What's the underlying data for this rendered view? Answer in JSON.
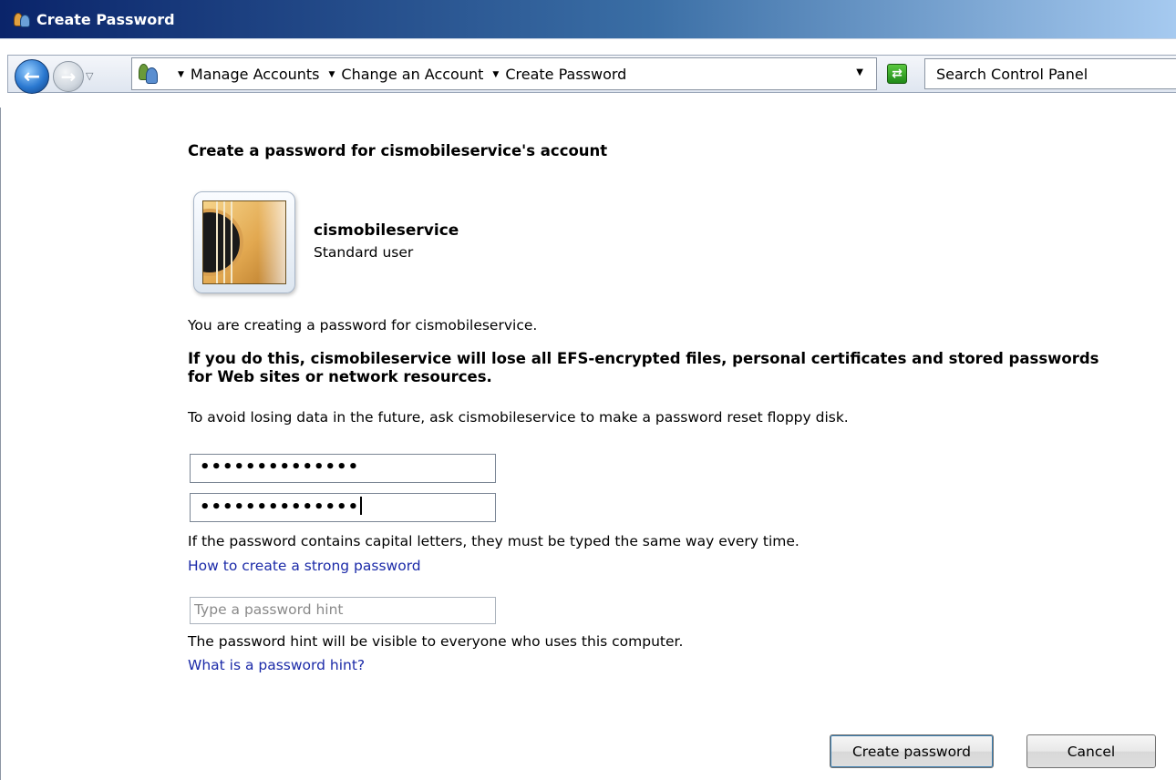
{
  "window": {
    "title": "Create Password"
  },
  "address_bar": {
    "breadcrumbs": [
      "Manage Accounts",
      "Change an Account",
      "Create Password"
    ],
    "search_placeholder": "Search Control Panel"
  },
  "main": {
    "heading": "Create a password for cismobileservice's account",
    "user": {
      "name": "cismobileservice",
      "role": "Standard user"
    },
    "info_text": "You are creating a password for cismobileservice.",
    "warning_text": "If you do this, cismobileservice will lose all EFS-encrypted files, personal certificates and stored passwords for Web sites or network resources.",
    "avoid_text": "To avoid losing data in the future, ask cismobileservice to make a password reset floppy disk.",
    "new_password_value": "••••••••••••••",
    "confirm_password_value": "••••••••••••••",
    "caps_text": "If the password contains capital letters, they must be typed the same way every time.",
    "strong_password_link": "How to create a strong password",
    "hint_placeholder": "Type a password hint",
    "hint_visibility_text": "The password hint will be visible to everyone who uses this computer.",
    "hint_help_link": "What is a password hint?"
  },
  "buttons": {
    "create": "Create password",
    "cancel": "Cancel"
  },
  "colors": {
    "link": "#1b2aa8",
    "titlebar_start": "#0a246a",
    "titlebar_end": "#a6caf0"
  }
}
